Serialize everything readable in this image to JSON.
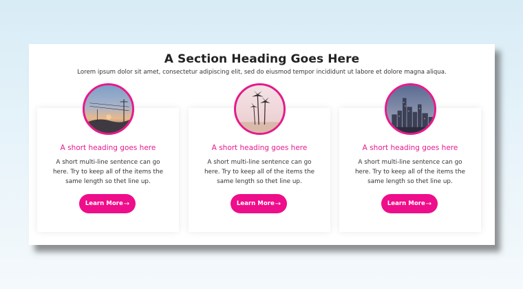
{
  "section": {
    "heading": "A Section Heading Goes Here",
    "subtitle": "Lorem ipsum dolor sit amet, consectetur adipiscing elit, sed do eiusmod tempor incididunt ut labore et dolore magna aliqua."
  },
  "accent_color": "#e8198b",
  "cards": [
    {
      "image": "sunset-power-lines-photo",
      "title": "A short heading goes here",
      "text": "A short multi-line sentence can go here. Try to keep all of the items the same length so thet line up.",
      "button_label": "Learn More",
      "button_icon": "→"
    },
    {
      "image": "palm-trees-photo",
      "title": "A short heading goes here",
      "text": "A short multi-line sentence can go here. Try to keep all of the items the same length so thet line up.",
      "button_label": "Learn More",
      "button_icon": "→"
    },
    {
      "image": "city-skyline-photo",
      "title": "A short heading goes here",
      "text": "A short multi-line sentence can go here. Try to keep all of the items the same length so thet line up.",
      "button_label": "Learn More",
      "button_icon": "→"
    }
  ]
}
